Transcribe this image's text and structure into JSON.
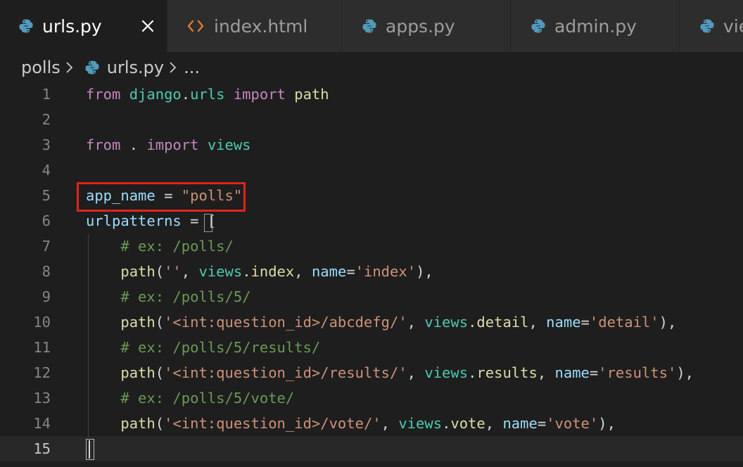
{
  "tabs": [
    {
      "label": "urls.py",
      "icon": "python-icon",
      "active": true,
      "close_glyph": "×"
    },
    {
      "label": "index.html",
      "icon": "html-icon",
      "icon_glyph": "<>",
      "active": false
    },
    {
      "label": "apps.py",
      "icon": "python-icon",
      "active": false
    },
    {
      "label": "admin.py",
      "icon": "python-icon",
      "active": false
    },
    {
      "label": "vie",
      "icon": "python-icon",
      "active": false
    }
  ],
  "breadcrumb": {
    "folder": "polls",
    "file": "urls.py",
    "more": "..."
  },
  "editor": {
    "current_line": 15,
    "highlighted_line": 5,
    "lines": [
      {
        "n": "1",
        "tokens": [
          {
            "t": "from",
            "c": "kw"
          },
          {
            "t": " ",
            "c": "pl"
          },
          {
            "t": "django",
            "c": "mod"
          },
          {
            "t": ".",
            "c": "pl"
          },
          {
            "t": "urls",
            "c": "mod"
          },
          {
            "t": " ",
            "c": "pl"
          },
          {
            "t": "import",
            "c": "kw"
          },
          {
            "t": " ",
            "c": "pl"
          },
          {
            "t": "path",
            "c": "fn"
          }
        ]
      },
      {
        "n": "2",
        "tokens": []
      },
      {
        "n": "3",
        "tokens": [
          {
            "t": "from",
            "c": "kw"
          },
          {
            "t": " . ",
            "c": "pl"
          },
          {
            "t": "import",
            "c": "kw"
          },
          {
            "t": " ",
            "c": "pl"
          },
          {
            "t": "views",
            "c": "mod"
          }
        ]
      },
      {
        "n": "4",
        "tokens": []
      },
      {
        "n": "5",
        "tokens": [
          {
            "t": "app_name",
            "c": "var"
          },
          {
            "t": " = ",
            "c": "pl"
          },
          {
            "t": "\"polls\"",
            "c": "str"
          }
        ]
      },
      {
        "n": "6",
        "tokens": [
          {
            "t": "urlpatterns",
            "c": "var"
          },
          {
            "t": " = ",
            "c": "pl"
          },
          {
            "t": "[",
            "c": "pl"
          }
        ]
      },
      {
        "n": "7",
        "tokens": [
          {
            "t": "    ",
            "c": "pl"
          },
          {
            "t": "# ex: /polls/",
            "c": "cm"
          }
        ]
      },
      {
        "n": "8",
        "tokens": [
          {
            "t": "    ",
            "c": "pl"
          },
          {
            "t": "path",
            "c": "fn"
          },
          {
            "t": "(",
            "c": "pl"
          },
          {
            "t": "''",
            "c": "str"
          },
          {
            "t": ", ",
            "c": "pl"
          },
          {
            "t": "views",
            "c": "mod"
          },
          {
            "t": ".",
            "c": "pl"
          },
          {
            "t": "index",
            "c": "fn"
          },
          {
            "t": ", ",
            "c": "pl"
          },
          {
            "t": "name",
            "c": "var"
          },
          {
            "t": "=",
            "c": "pl"
          },
          {
            "t": "'index'",
            "c": "str"
          },
          {
            "t": "),",
            "c": "pl"
          }
        ]
      },
      {
        "n": "9",
        "tokens": [
          {
            "t": "    ",
            "c": "pl"
          },
          {
            "t": "# ex: /polls/5/",
            "c": "cm"
          }
        ]
      },
      {
        "n": "10",
        "tokens": [
          {
            "t": "    ",
            "c": "pl"
          },
          {
            "t": "path",
            "c": "fn"
          },
          {
            "t": "(",
            "c": "pl"
          },
          {
            "t": "'<int:question_id>/abcdefg/'",
            "c": "str"
          },
          {
            "t": ", ",
            "c": "pl"
          },
          {
            "t": "views",
            "c": "mod"
          },
          {
            "t": ".",
            "c": "pl"
          },
          {
            "t": "detail",
            "c": "fn"
          },
          {
            "t": ", ",
            "c": "pl"
          },
          {
            "t": "name",
            "c": "var"
          },
          {
            "t": "=",
            "c": "pl"
          },
          {
            "t": "'detail'",
            "c": "str"
          },
          {
            "t": "),",
            "c": "pl"
          }
        ]
      },
      {
        "n": "11",
        "tokens": [
          {
            "t": "    ",
            "c": "pl"
          },
          {
            "t": "# ex: /polls/5/results/",
            "c": "cm"
          }
        ]
      },
      {
        "n": "12",
        "tokens": [
          {
            "t": "    ",
            "c": "pl"
          },
          {
            "t": "path",
            "c": "fn"
          },
          {
            "t": "(",
            "c": "pl"
          },
          {
            "t": "'<int:question_id>/results/'",
            "c": "str"
          },
          {
            "t": ", ",
            "c": "pl"
          },
          {
            "t": "views",
            "c": "mod"
          },
          {
            "t": ".",
            "c": "pl"
          },
          {
            "t": "results",
            "c": "fn"
          },
          {
            "t": ", ",
            "c": "pl"
          },
          {
            "t": "name",
            "c": "var"
          },
          {
            "t": "=",
            "c": "pl"
          },
          {
            "t": "'results'",
            "c": "str"
          },
          {
            "t": "),",
            "c": "pl"
          }
        ]
      },
      {
        "n": "13",
        "tokens": [
          {
            "t": "    ",
            "c": "pl"
          },
          {
            "t": "# ex: /polls/5/vote/",
            "c": "cm"
          }
        ]
      },
      {
        "n": "14",
        "tokens": [
          {
            "t": "    ",
            "c": "pl"
          },
          {
            "t": "path",
            "c": "fn"
          },
          {
            "t": "(",
            "c": "pl"
          },
          {
            "t": "'<int:question_id>/vote/'",
            "c": "str"
          },
          {
            "t": ", ",
            "c": "pl"
          },
          {
            "t": "views",
            "c": "mod"
          },
          {
            "t": ".",
            "c": "pl"
          },
          {
            "t": "vote",
            "c": "fn"
          },
          {
            "t": ", ",
            "c": "pl"
          },
          {
            "t": "name",
            "c": "var"
          },
          {
            "t": "=",
            "c": "pl"
          },
          {
            "t": "'vote'",
            "c": "str"
          },
          {
            "t": "),",
            "c": "pl"
          }
        ]
      },
      {
        "n": "15",
        "tokens": []
      }
    ]
  },
  "colors": {
    "highlight_box": "#e0241b",
    "background": "#1e1e1e",
    "python_icon_blue": "#519aba"
  }
}
